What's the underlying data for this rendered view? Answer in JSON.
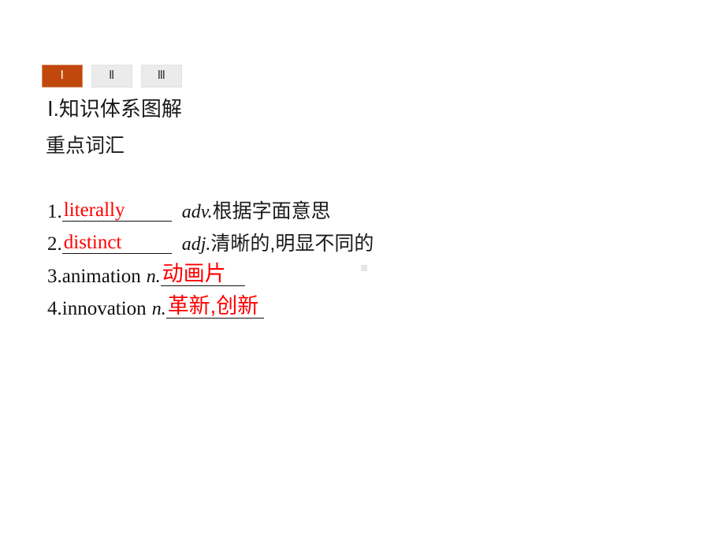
{
  "tabs": [
    {
      "label": "Ⅰ",
      "state": "active"
    },
    {
      "label": "Ⅱ",
      "state": "inactive"
    },
    {
      "label": "Ⅲ",
      "state": "inactive"
    }
  ],
  "headings": {
    "section_numeral": "Ⅰ",
    "section_title": ".知识体系图解",
    "sub_title": "重点词汇"
  },
  "vocab": [
    {
      "index": "1.",
      "layout": "blank-first",
      "answer": "literally",
      "answer_lang": "en",
      "pos": "adv.",
      "gloss": "根据字面意思"
    },
    {
      "index": "2.",
      "layout": "blank-first",
      "answer": "distinct",
      "answer_lang": "en",
      "pos": "adj.",
      "gloss": "清晰的,明显不同的"
    },
    {
      "index": "3.",
      "layout": "word-first",
      "headword": "animation",
      "pos": "n.",
      "answer": "动画片",
      "answer_lang": "cn"
    },
    {
      "index": "4.",
      "layout": "word-first",
      "headword": "innovation",
      "pos": "n.",
      "answer": "革新,创新",
      "answer_lang": "cn"
    }
  ],
  "colors": {
    "tab_active_bg": "#c1480c",
    "tab_inactive_bg": "#ebebeb",
    "answer_red": "#ff0000",
    "text_black": "#111111"
  }
}
